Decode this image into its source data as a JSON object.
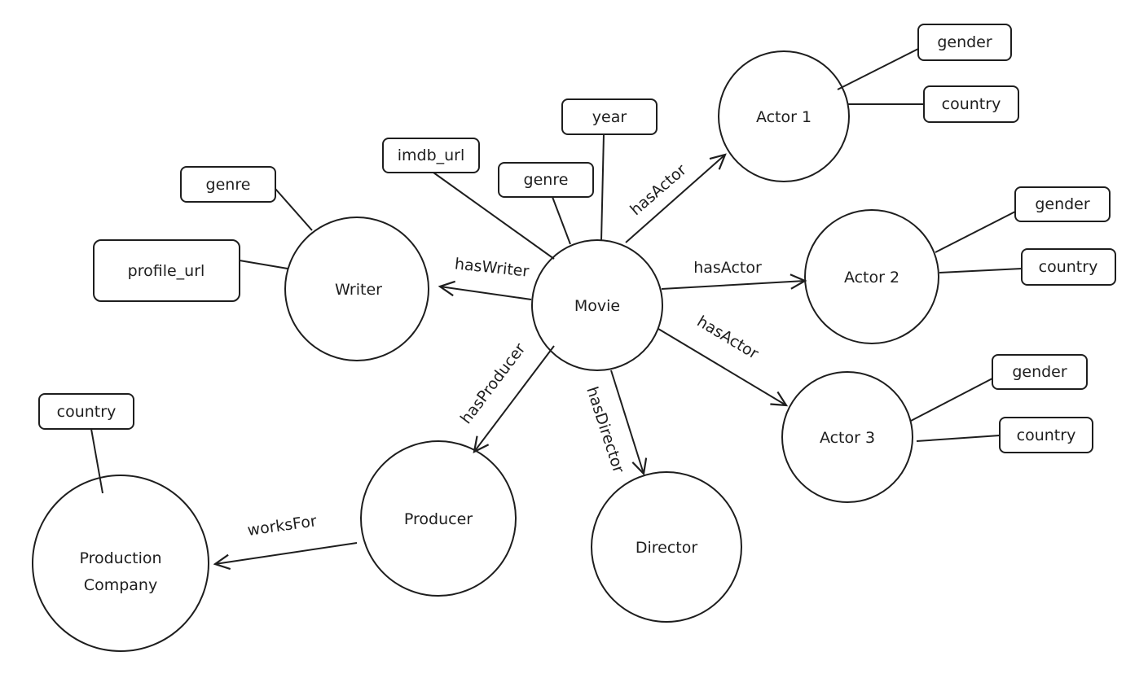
{
  "nodes": {
    "movie": "Movie",
    "writer": "Writer",
    "actor1": "Actor 1",
    "actor2": "Actor 2",
    "actor3": "Actor 3",
    "producer": "Producer",
    "director": "Director",
    "company_line1": "Production",
    "company_line2": "Company"
  },
  "attributes": {
    "movie_year": "year",
    "movie_imdb_url": "imdb_url",
    "movie_genre": "genre",
    "writer_genre": "genre",
    "writer_profile_url": "profile_url",
    "actor1_gender": "gender",
    "actor1_country": "country",
    "actor2_gender": "gender",
    "actor2_country": "country",
    "actor3_gender": "gender",
    "actor3_country": "country",
    "company_country": "country"
  },
  "edges": {
    "has_actor_1": "hasActor",
    "has_actor_2": "hasActor",
    "has_actor_3": "hasActor",
    "has_writer": "hasWriter",
    "has_producer": "hasProducer",
    "has_director": "hasDirector",
    "works_for": "worksFor"
  }
}
